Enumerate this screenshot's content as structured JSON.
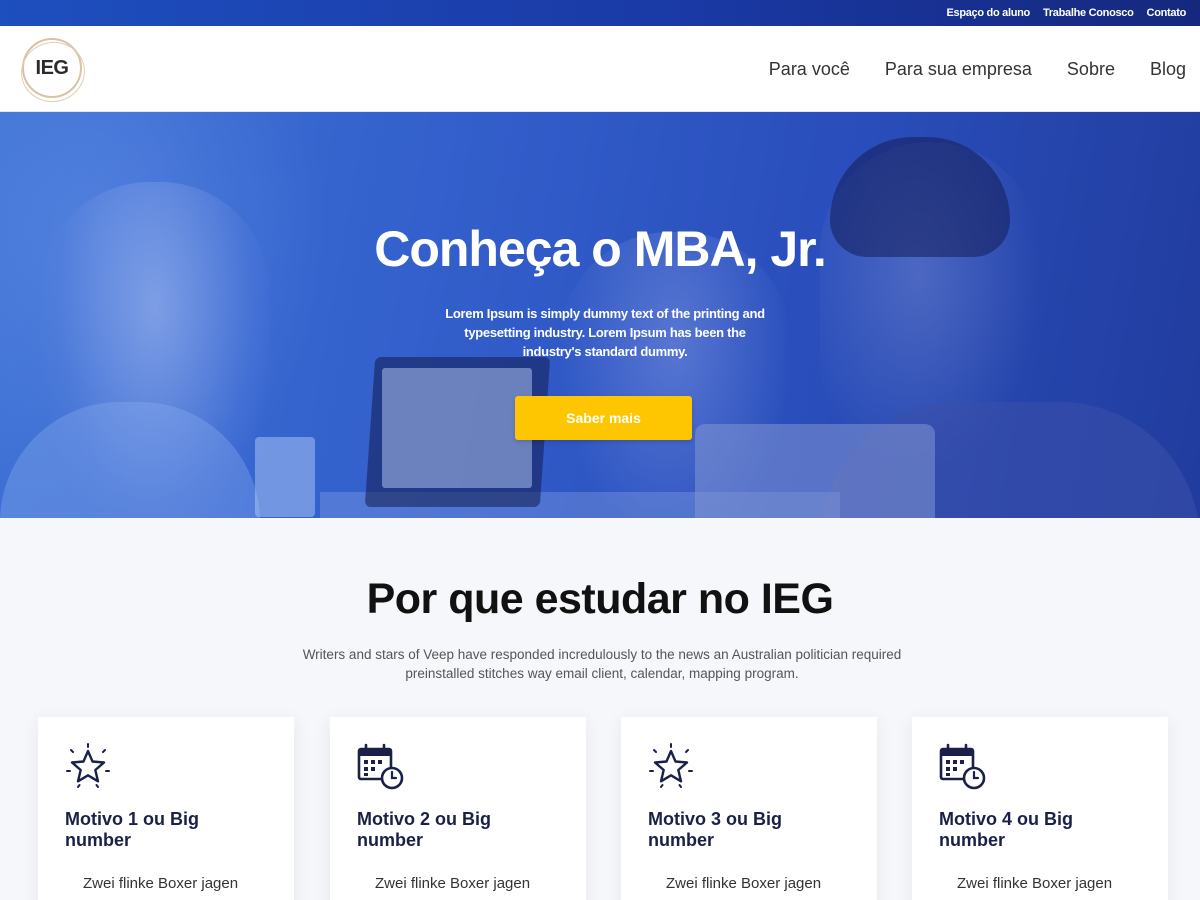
{
  "topbar": {
    "links": [
      "Espaço do aluno",
      "Trabalhe Conosco",
      "Contato"
    ]
  },
  "header": {
    "logo_text": "IEG",
    "nav": [
      "Para você",
      "Para sua empresa",
      "Sobre",
      "Blog"
    ]
  },
  "hero": {
    "title": "Conheça o MBA, Jr.",
    "text": "Lorem Ipsum is simply dummy text of the printing and typesetting industry. Lorem Ipsum has been the industry's standard dummy.",
    "button_label": "Saber mais"
  },
  "why": {
    "title": "Por que estudar no IEG",
    "subtitle": "Writers and stars of Veep have responded incredulously to the news an Australian politician required preinstalled stitches way email client, calendar, mapping program.",
    "cards": [
      {
        "icon": "star-icon",
        "title": "Motivo 1 ou Big number",
        "text": "Zwei flinke Boxer jagen"
      },
      {
        "icon": "calendar-clock-icon",
        "title": "Motivo 2 ou Big number",
        "text": "Zwei flinke Boxer jagen"
      },
      {
        "icon": "star-icon",
        "title": "Motivo 3 ou Big number",
        "text": "Zwei flinke Boxer jagen"
      },
      {
        "icon": "calendar-clock-icon",
        "title": "Motivo 4 ou Big number",
        "text": "Zwei flinke Boxer jagen"
      }
    ]
  },
  "colors": {
    "primary_blue": "#2a4fbd",
    "accent_yellow": "#fec601",
    "card_title": "#1a2048"
  }
}
